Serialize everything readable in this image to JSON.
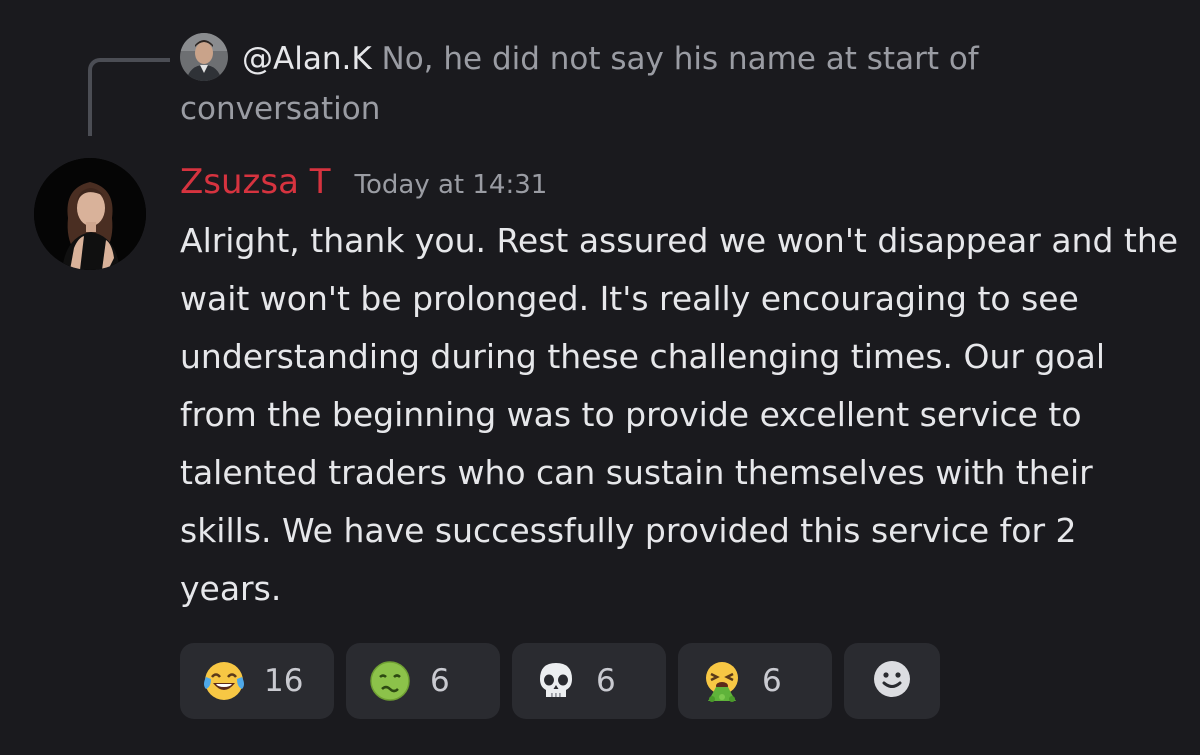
{
  "reply": {
    "author": "@Alan.K",
    "text": " No, he did not say his name at start of conversation"
  },
  "message": {
    "author": "Zsuzsa T",
    "timestamp": "Today at 14:31",
    "body": "Alright, thank you. Rest assured we won't disappear and the wait won't be prolonged. It's really encouraging to see understanding during these challenging times. Our goal from the beginning was to provide excellent service to talented traders who can sustain themselves with their skills. We have successfully provided this service for 2 years.",
    "author_color": "#d6333f"
  },
  "reactions": [
    {
      "emoji": "face-with-tears-of-joy",
      "count": "16"
    },
    {
      "emoji": "nauseated-face",
      "count": "6"
    },
    {
      "emoji": "skull",
      "count": "6"
    },
    {
      "emoji": "vomiting-face",
      "count": "6"
    }
  ],
  "add_reaction_icon": "add-reaction-smiley-icon",
  "theme": {
    "background": "#1a1a1e",
    "pill": "#2a2b30",
    "text": "#e6e7ea",
    "muted": "#9a9ca3"
  }
}
